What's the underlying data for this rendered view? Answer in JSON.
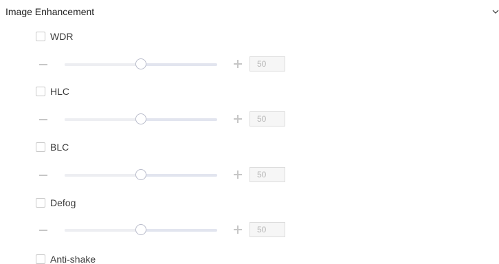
{
  "section": {
    "title": "Image Enhancement",
    "collapse_icon": "chevron-down-icon"
  },
  "features": [
    {
      "label": "WDR",
      "checked": false,
      "slider": {
        "value": "50",
        "level_fraction": 0.5
      }
    },
    {
      "label": "HLC",
      "checked": false,
      "slider": {
        "value": "50",
        "level_fraction": 0.5
      }
    },
    {
      "label": "BLC",
      "checked": false,
      "slider": {
        "value": "50",
        "level_fraction": 0.5
      }
    },
    {
      "label": "Defog",
      "checked": false,
      "slider": {
        "value": "50",
        "level_fraction": 0.5
      }
    },
    {
      "label": "Anti-shake",
      "checked": false
    }
  ],
  "icons": {
    "decrease": "minus-icon",
    "increase": "plus-icon"
  },
  "colors": {
    "text": "#1f1f1f",
    "disabled_text": "#b7b7b7",
    "track": "#e2e5ef",
    "thumb_border": "#b9bccb"
  }
}
